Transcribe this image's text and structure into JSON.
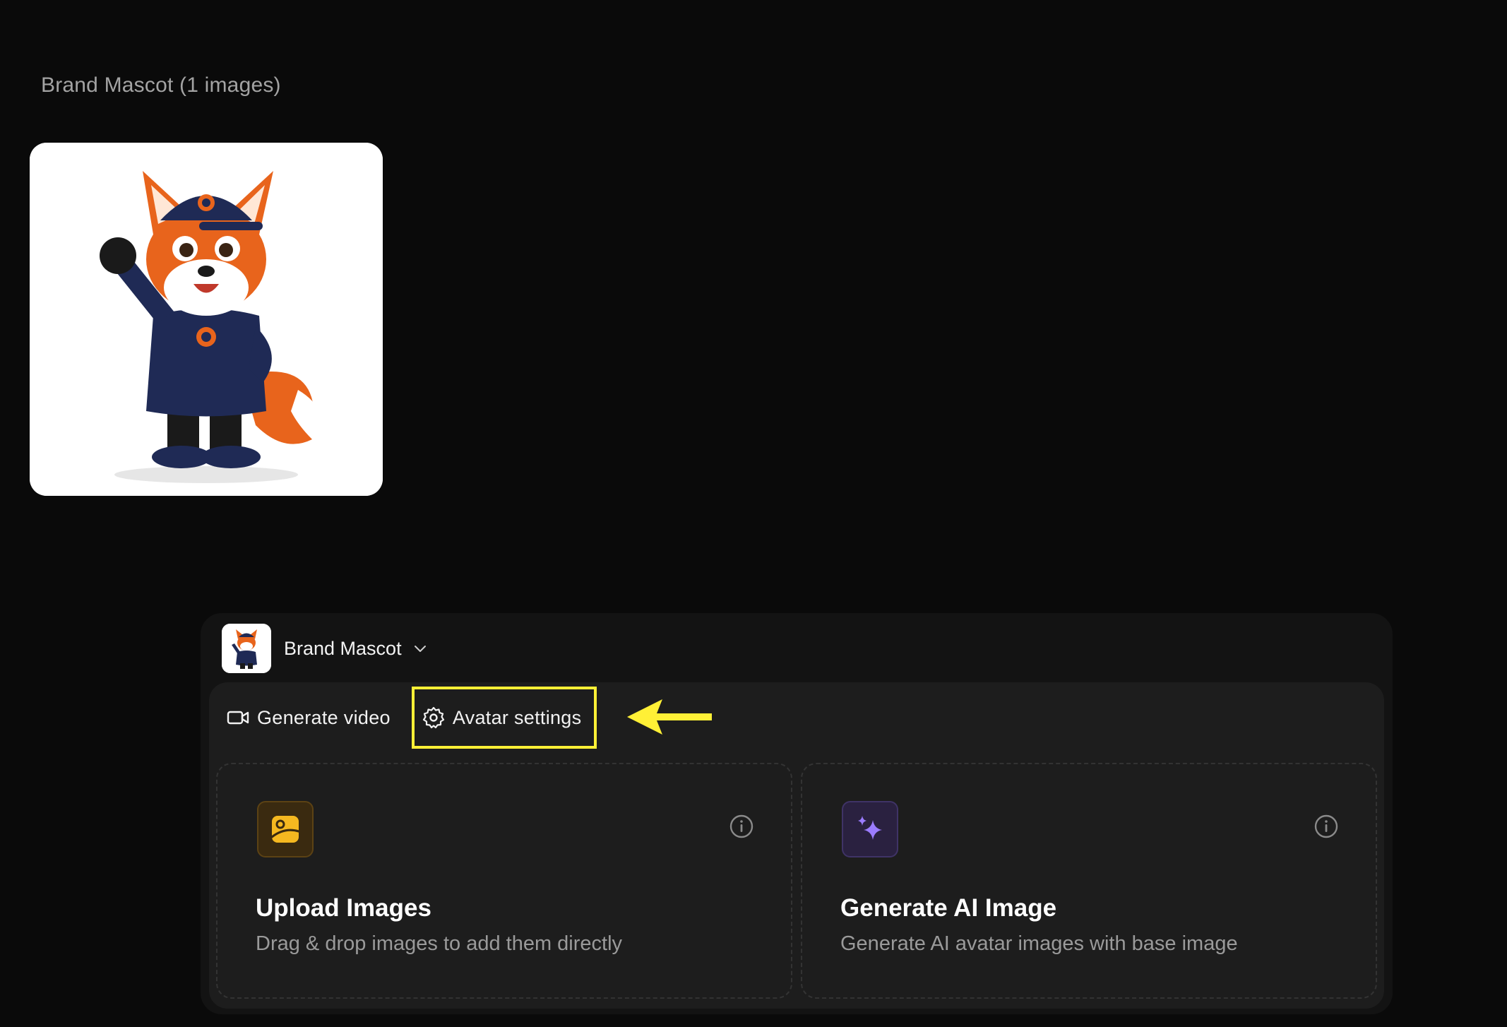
{
  "gallery": {
    "title": "Brand Mascot (1 images)",
    "image_alt": "fox-mascot"
  },
  "panel": {
    "avatar": {
      "name": "Brand Mascot",
      "icon": "chevron-down-icon"
    },
    "tabs": [
      {
        "label": "Generate video",
        "icon": "video-camera-icon"
      },
      {
        "label": "Avatar settings",
        "icon": "gear-icon",
        "highlighted": true
      }
    ],
    "annotation": {
      "icon": "arrow-left-icon",
      "color": "#fff036"
    },
    "cards": [
      {
        "title": "Upload Images",
        "description": "Drag & drop images to add them directly",
        "icon": "image-upload-icon",
        "accent": "#f5b820"
      },
      {
        "title": "Generate AI Image",
        "description": "Generate AI avatar images with base image",
        "icon": "sparkles-icon",
        "accent": "#9b7cff"
      }
    ]
  }
}
